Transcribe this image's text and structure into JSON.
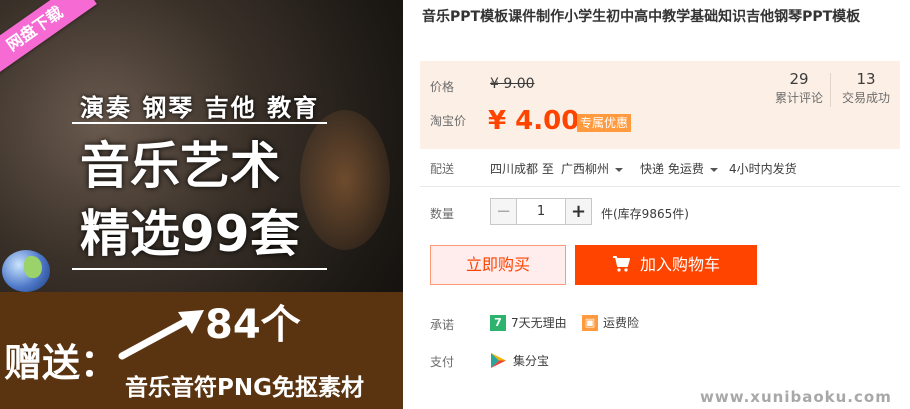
{
  "banner": {
    "ribbon": "网盘下载",
    "tagline": "演奏 钢琴 吉他 教育",
    "title_line1": "音乐艺术",
    "title_line2": "精选99套",
    "gift": "赠送：",
    "count": "84个",
    "material": "音乐音符PNG免抠素材"
  },
  "product": {
    "title": "音乐PPT模板课件制作小学生初中高中教学基础知识吉他钢琴PPT模板"
  },
  "price": {
    "label": "价格",
    "original": "¥ 9.00",
    "promo_label": "淘宝价",
    "current": "¥ 4.00",
    "tag": "专属优惠",
    "accent_color": "#ff4400"
  },
  "stats": {
    "reviews_count": "29",
    "reviews_label": "累计评论",
    "deals_count": "13",
    "deals_label": "交易成功"
  },
  "shipping": {
    "label": "配送",
    "from": "四川成都 至",
    "to": "广西柳州",
    "method": "快递 免运费",
    "dispatch": "4小时内发货"
  },
  "quantity": {
    "label": "数量",
    "minus": "−",
    "value": "1",
    "plus": "+",
    "stock": "件(库存9865件)"
  },
  "actions": {
    "buy_now": "立即购买",
    "add_to_cart": "加入购物车"
  },
  "promise": {
    "label": "承诺",
    "return_badge": "7",
    "return_text": "7天无理由",
    "insurance_text": "运费险"
  },
  "payment": {
    "label": "支付",
    "method": "集分宝"
  },
  "watermark": "www.xunibaoku.com",
  "icons": [
    "cart-icon",
    "return-7day-icon",
    "shipping-insurance-icon",
    "jifenbao-icon",
    "caret-down-icon"
  ]
}
